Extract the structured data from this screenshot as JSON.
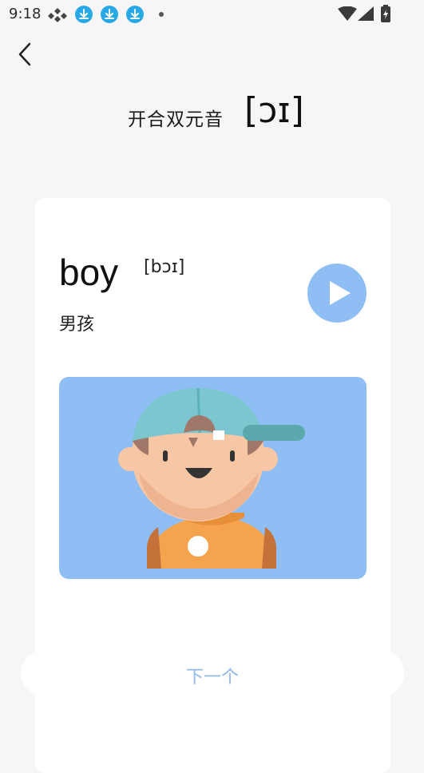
{
  "status_bar": {
    "time": "9:18",
    "icons": [
      "app-icon",
      "download-icon",
      "download-icon",
      "download-icon",
      "dot-icon",
      "wifi-icon",
      "signal-icon",
      "battery-icon"
    ]
  },
  "header": {
    "category": "开合双元音",
    "phoneme": "[ɔɪ]"
  },
  "card": {
    "word": "boy",
    "phonetic": "[bɔɪ]",
    "meaning": "男孩",
    "play_icon": "play-icon",
    "illustration": "boy-with-cap-illustration"
  },
  "footer": {
    "next_label": "下一个"
  },
  "colors": {
    "accent": "#8fbef4",
    "next_text": "#8fb8ea",
    "background": "#f6f6f6"
  }
}
